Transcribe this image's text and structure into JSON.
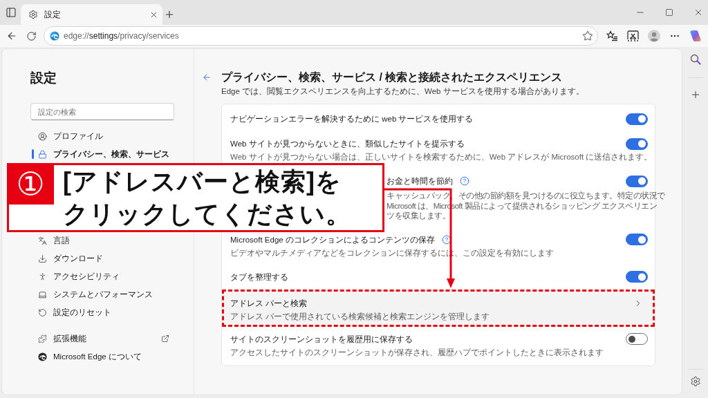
{
  "browser": {
    "tab_title": "設定",
    "url": "edge://**settings**/privacy/services"
  },
  "sidebar": {
    "title": "設定",
    "search": {
      "placeholder": "設定の検索"
    },
    "groups": [
      {
        "items": [
          {
            "label": "プロファイル",
            "selected": false,
            "external": false
          },
          {
            "label": "プライバシー、検索、サービス",
            "selected": true,
            "external": false
          }
        ]
      },
      {
        "items": [
          {
            "label": "言語",
            "selected": false,
            "external": false
          },
          {
            "label": "ダウンロード",
            "selected": false,
            "external": false
          },
          {
            "label": "アクセシビリティ",
            "selected": false,
            "external": false
          },
          {
            "label": "システムとパフォーマンス",
            "selected": false,
            "external": false
          },
          {
            "label": "設定のリセット",
            "selected": false,
            "external": false
          }
        ]
      },
      {
        "items": [
          {
            "label": "拡張機能",
            "selected": false,
            "external": true
          },
          {
            "label": "Microsoft Edge について",
            "selected": false,
            "external": false
          }
        ]
      }
    ]
  },
  "page": {
    "title": "プライバシー、検索、サービス / 検索と接続されたエクスペリエンス",
    "subtitle": "Edge では、閲覧エクスペリエンスを向上するために、Web サービスを使用する場合があります。"
  },
  "settings": [
    {
      "kind": "toggle",
      "title": "ナビゲーションエラーを解決するために web サービスを使用する",
      "help": false,
      "on": true,
      "highlighted": false
    },
    {
      "kind": "toggle",
      "title": "Web サイトが見つからないときに、類似したサイトを提示する",
      "description": "Web サイトが見つからない場合は、正しいサイトを検索するために、Web アドレスが Microsoft に送信されます。",
      "help": false,
      "on": true,
      "highlighted": false
    },
    {
      "kind": "covered",
      "title": "お金と時間を節約",
      "description_lines": [
        "キャッシュバック、その他の節約額を見つけるのに役立ちます。特定の状況で",
        "Microsoft は、Microsoft 製品によって提供されるショッピング エクスペリエン",
        "ツを収集します。"
      ],
      "help": true,
      "on": true,
      "highlighted": false
    },
    {
      "kind": "toggle",
      "title": "Microsoft Edge のコレクションによるコンテンツの保存",
      "description": "ビデオやマルチメディアなどをコレクションに保存するには、この設定を有効にします",
      "help": true,
      "on": true,
      "highlighted": false
    },
    {
      "kind": "toggle",
      "title": "タブを整理する",
      "help": false,
      "on": true,
      "highlighted": false
    },
    {
      "kind": "link",
      "title": "アドレス バーと検索",
      "description": "アドレス バーで使用されている検索候補と検索エンジンを管理します",
      "highlighted": true
    },
    {
      "kind": "toggle",
      "title": "サイトのスクリーンショットを履歴用に保存する",
      "description": "アクセスしたサイトのスクリーンショットが保存され、履歴ハブでポイントしたときに表示されます",
      "help": false,
      "on": false,
      "highlighted": false
    }
  ],
  "callout": {
    "step": "①",
    "lines": [
      "[アドレスバーと検索]を",
      "クリックしてください。"
    ]
  }
}
